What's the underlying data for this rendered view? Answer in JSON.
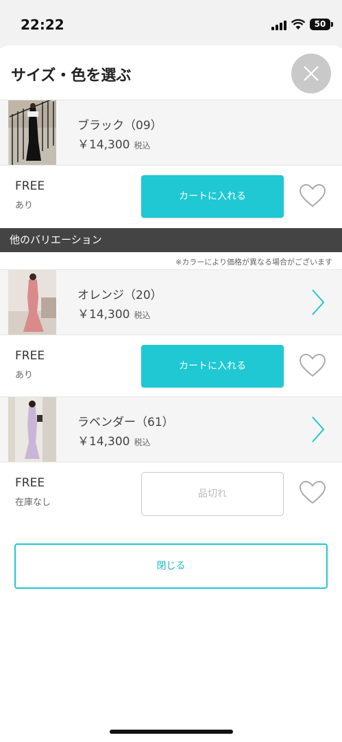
{
  "status_bar": {
    "time": "22:22",
    "battery": "50"
  },
  "sheet": {
    "title": "サイズ・色を選ぶ"
  },
  "selected_product": {
    "name": "ブラック（09）",
    "price": "￥14,300",
    "tax": "税込",
    "size": "FREE",
    "stock": "あり",
    "cart_label": "カートに入れる"
  },
  "variations": {
    "header": "他のバリエーション",
    "note": "※カラーにより価格が異なる場合がございます",
    "items": [
      {
        "name": "オレンジ（20）",
        "price": "￥14,300",
        "tax": "税込",
        "size": "FREE",
        "stock": "あり",
        "button_label": "カートに入れる",
        "swatch": "#d98a8a"
      },
      {
        "name": "ラベンダー（61）",
        "price": "￥14,300",
        "tax": "税込",
        "size": "FREE",
        "stock": "在庫なし",
        "button_label": "品切れ",
        "swatch": "#c9b6d6"
      }
    ]
  },
  "close_button_label": "閉じる",
  "colors": {
    "accent": "#1fc8d2",
    "dark_header": "#444444",
    "close_circle": "#c9c9c9"
  }
}
